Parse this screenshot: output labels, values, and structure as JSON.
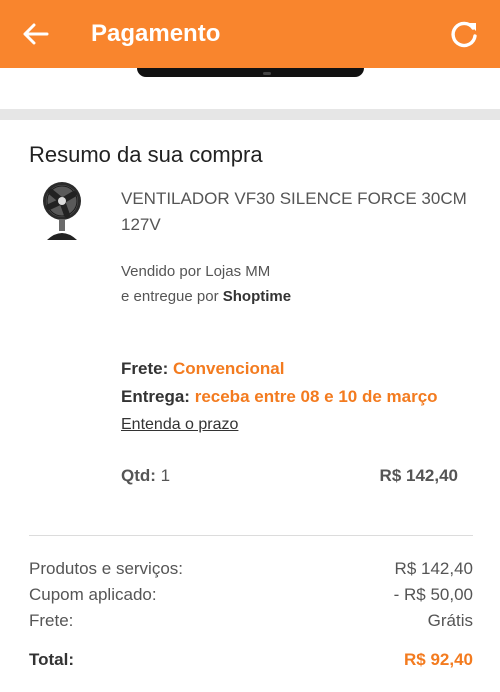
{
  "header": {
    "title": "Pagamento",
    "background": "#f9852d",
    "back_icon": "arrow-left-icon",
    "refresh_icon": "refresh-icon"
  },
  "summary": {
    "title": "Resumo da sua compra",
    "product": {
      "name": "VENTILADOR VF30 SILENCE FORCE 30CM 127V",
      "image_icon": "fan-icon",
      "sold_by_prefix": "Vendido por",
      "sold_by": "Lojas MM",
      "delivered_by_prefix": "e entregue por",
      "delivered_by": "Shoptime"
    },
    "shipping": {
      "frete_label": "Frete:",
      "frete_value": "Convencional",
      "entrega_label": "Entrega:",
      "entrega_value": "receba entre 08 e 10 de março",
      "prazo_link": "Entenda o prazo"
    },
    "qty_label": "Qtd:",
    "qty_value": "1",
    "item_price": "R$ 142,40"
  },
  "totals": {
    "produtos_label": "Produtos e serviços:",
    "produtos_value": "R$ 142,40",
    "cupom_label": "Cupom aplicado:",
    "cupom_value": "- R$ 50,00",
    "frete_label": "Frete:",
    "frete_value": "Grátis",
    "total_label": "Total:",
    "total_value": "R$ 92,40"
  },
  "colors": {
    "accent": "#f37b1f",
    "text": "#555555"
  }
}
